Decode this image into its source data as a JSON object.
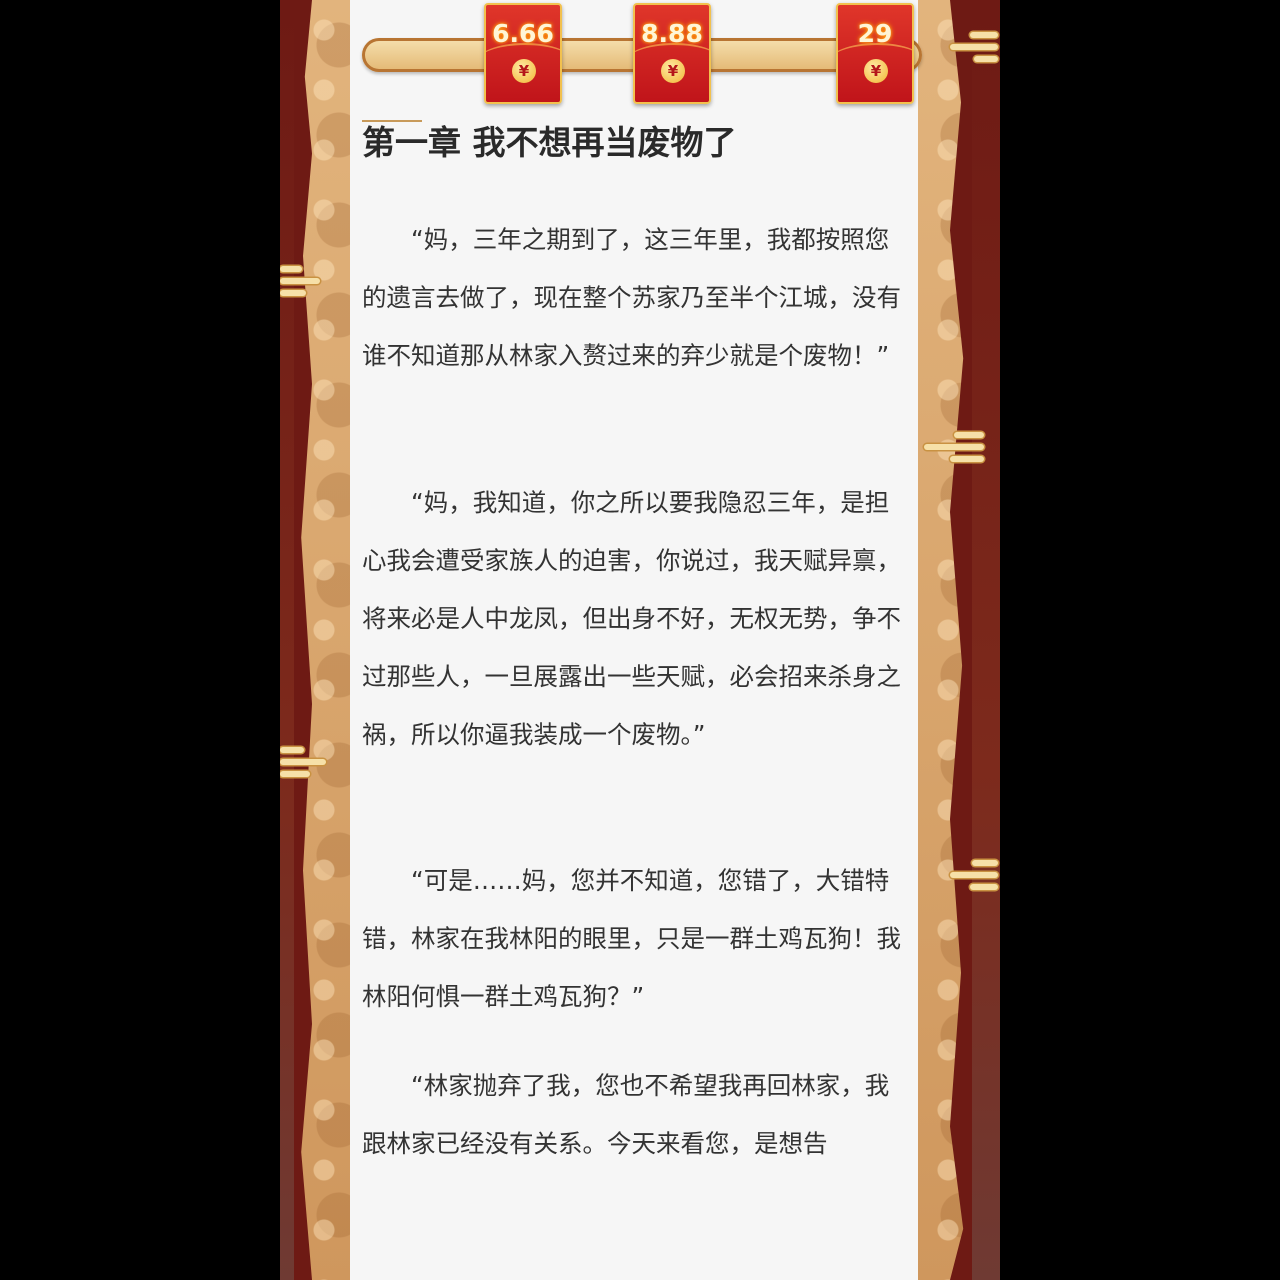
{
  "rewards": {
    "progress_fraction": 0.0,
    "envelopes": [
      {
        "amount": "6.66",
        "icon": "yuan-coin-icon",
        "symbol": "¥"
      },
      {
        "amount": "8.88",
        "icon": "yuan-coin-icon",
        "symbol": "¥"
      },
      {
        "amount": "29",
        "icon": "yuan-coin-icon",
        "symbol": "¥"
      }
    ]
  },
  "chapter": {
    "title": "第一章  我不想再当废物了",
    "paragraphs": [
      "“妈，三年之期到了，这三年里，我都按照您的遗言去做了，现在整个苏家乃至半个江城，没有谁不知道那从林家入赘过来的弃少就是个废物！”",
      "“妈，我知道，你之所以要我隐忍三年，是担心我会遭受家族人的迫害，你说过，我天赋异禀，将来必是人中龙凤，但出身不好，无权无势，争不过那些人，一旦展露出一些天赋，必会招来杀身之祸，所以你逼我装成一个废物。”",
      "“可是……妈，您并不知道，您错了，大错特错，林家在我林阳的眼里，只是一群土鸡瓦狗！我林阳何惧一群土鸡瓦狗？”",
      "“林家抛弃了我，您也不希望我再回林家，我跟林家已经没有关系。今天来看您，是想告"
    ]
  },
  "theme": {
    "border_red": "#6e1a14",
    "panel_tan": "#d9a46a",
    "page_bg": "#f6f6f6",
    "envelope_red": "#c0141a",
    "gold": "#f2c14e"
  },
  "decor_icons": [
    "cloud-ornament-icon"
  ]
}
